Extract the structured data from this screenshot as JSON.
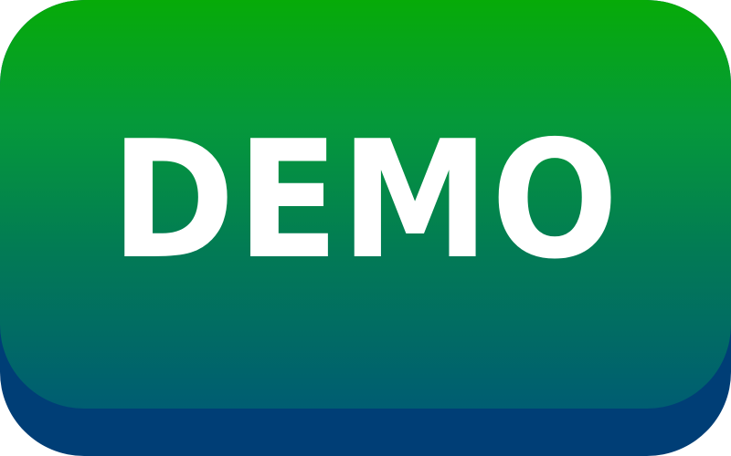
{
  "button": {
    "label": "DEMO"
  },
  "colors": {
    "face_top": "#06ab08",
    "face_bottom": "#005d72",
    "base": "#003e76",
    "label": "#ffffff"
  }
}
